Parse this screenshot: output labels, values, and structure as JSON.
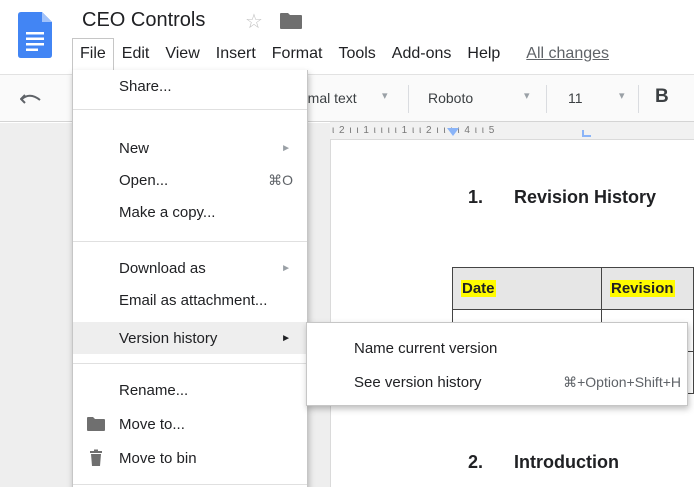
{
  "header": {
    "doc_title": "CEO Controls",
    "menu": [
      "File",
      "Edit",
      "View",
      "Insert",
      "Format",
      "Tools",
      "Add-ons",
      "Help"
    ],
    "all_changes": "All changes"
  },
  "toolbar": {
    "style": "rmal text",
    "font": "Roboto",
    "size": "11",
    "bold": "B"
  },
  "ruler": {
    "marks": "ι 2 ι ι 1 ι ι ι     ι 1 ι ι 2 ι ι     ι ι 4 ι ι 5"
  },
  "document": {
    "heading1": {
      "num": "1.",
      "text": "Revision History"
    },
    "table_headers": [
      "Date",
      "Revision"
    ],
    "heading2": {
      "num": "2.",
      "text": "Introduction"
    }
  },
  "file_menu": {
    "items": [
      {
        "label": "Share...",
        "icon": "",
        "shortcut": "",
        "has_submenu": false
      },
      {
        "label": "New",
        "icon": "",
        "shortcut": "",
        "has_submenu": true
      },
      {
        "label": "Open...",
        "icon": "",
        "shortcut": "⌘O",
        "has_submenu": false
      },
      {
        "label": "Make a copy...",
        "icon": "",
        "shortcut": "",
        "has_submenu": false
      },
      {
        "label": "Download as",
        "icon": "",
        "shortcut": "",
        "has_submenu": true
      },
      {
        "label": "Email as attachment...",
        "icon": "",
        "shortcut": "",
        "has_submenu": false
      },
      {
        "label": "Version history",
        "icon": "",
        "shortcut": "",
        "has_submenu": true,
        "highlighted": true
      },
      {
        "label": "Rename...",
        "icon": "",
        "shortcut": "",
        "has_submenu": false
      },
      {
        "label": "Move to...",
        "icon": "folder-icon",
        "shortcut": "",
        "has_submenu": false
      },
      {
        "label": "Move to bin",
        "icon": "trash-icon",
        "shortcut": "",
        "has_submenu": false
      }
    ],
    "arrow_glyph": "►"
  },
  "version_submenu": {
    "items": [
      {
        "label": "Name current version",
        "shortcut": ""
      },
      {
        "label": "See version history",
        "shortcut": "⌘+Option+Shift+H"
      }
    ]
  },
  "colors": {
    "doc_blue": "#4285f4",
    "highlight": "#fffb00",
    "menu_hover": "#eeeeee"
  }
}
